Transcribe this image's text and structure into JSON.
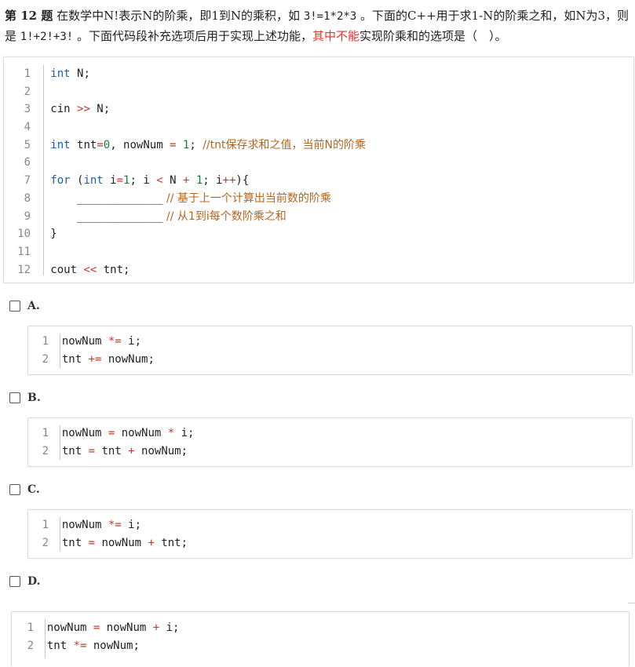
{
  "question": {
    "number_label": "第 12 题",
    "text_1": " 在数学中N!表示N的阶乘，即1到N的乘积，如 ",
    "code_1": "3!=1*2*3",
    "text_2": " 。下面的C++用于求1-N的阶乘之和，如N为3，则是 ",
    "code_2": "1!+2!+3!",
    "text_3": " 。下面代码段补充选项后用于实现上述功能，",
    "highlight": "其中不能",
    "text_4": "实现阶乘和的选项是（　）。"
  },
  "main_code": {
    "line_numbers": [
      "1",
      "2",
      "3",
      "4",
      "5",
      "6",
      "7",
      "8",
      "9",
      "10",
      "11",
      "12"
    ],
    "l1_kw": "int",
    "l1_rest": " N;",
    "l3_a": "cin ",
    "l3_op": ">>",
    "l3_b": " N;",
    "l5_kw": "int",
    "l5_a": " tnt",
    "l5_eq1": "=",
    "l5_n0": "0",
    "l5_b": ", nowNum ",
    "l5_eq2": "=",
    "l5_c": " ",
    "l5_n1": "1",
    "l5_d": "; ",
    "l5_cm": "//tnt保存求和之值，当前N的阶乘",
    "l7_kw1": "for",
    "l7_a": " (",
    "l7_kw2": "int",
    "l7_b": " i",
    "l7_eq": "=",
    "l7_n1": "1",
    "l7_c": "; i ",
    "l7_lt": "<",
    "l7_d": " N ",
    "l7_plus": "+",
    "l7_e": " ",
    "l7_n2": "1",
    "l7_f": "; i",
    "l7_inc": "++",
    "l7_g": "){",
    "l8_blank": "_____________",
    "l8_cm": " // 基于上一个计算出当前数的阶乘",
    "l9_blank": "_____________",
    "l9_cm": " // 从1到i每个数阶乘之和",
    "l10": "}",
    "l12_a": "cout ",
    "l12_op": "<<",
    "l12_b": " tnt;"
  },
  "options": [
    {
      "label": "A.",
      "line_numbers": [
        "1",
        "2"
      ],
      "l1_a": "nowNum ",
      "l1_op": "*=",
      "l1_b": " i;",
      "l2_a": "tnt ",
      "l2_op": "+=",
      "l2_b": " nowNum;"
    },
    {
      "label": "B.",
      "line_numbers": [
        "1",
        "2"
      ],
      "l1_a": "nowNum ",
      "l1_op1": "=",
      "l1_b": " nowNum ",
      "l1_op2": "*",
      "l1_c": " i;",
      "l2_a": "tnt ",
      "l2_op1": "=",
      "l2_b": " tnt ",
      "l2_op2": "+",
      "l2_c": " nowNum;"
    },
    {
      "label": "C.",
      "line_numbers": [
        "1",
        "2"
      ],
      "l1_a": "nowNum ",
      "l1_op": "*=",
      "l1_b": " i;",
      "l2_a": "tnt ",
      "l2_op1": "=",
      "l2_b": " nowNum ",
      "l2_op2": "+",
      "l2_c": " tnt;"
    },
    {
      "label": "D.",
      "line_numbers": [
        "1",
        "2"
      ],
      "l1_a": "nowNum ",
      "l1_op1": "=",
      "l1_b": " nowNum ",
      "l1_op2": "+",
      "l1_c": " i;",
      "l2_a": "tnt ",
      "l2_op": "*=",
      "l2_b": " nowNum;"
    }
  ]
}
